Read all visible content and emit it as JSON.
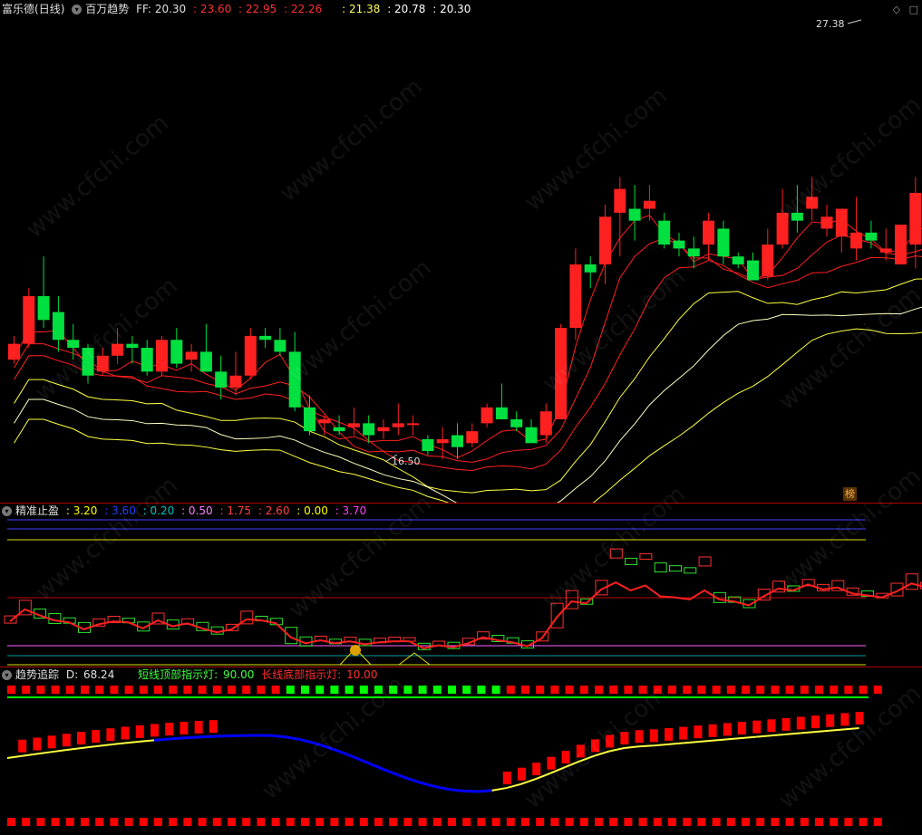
{
  "main": {
    "stock_name": "富乐德",
    "period": "(日线)",
    "indicator": "百万趋势",
    "ff_label": "FF:",
    "ff_value": "20.30",
    "red_values": [
      ": 23.60",
      ": 22.95",
      ": 22.26"
    ],
    "white_values": [
      ": 21.38",
      ": 20.78",
      ": 20.30"
    ],
    "high_label": "27.38",
    "low_label": "16.50",
    "rank_badge": "榜"
  },
  "panel2": {
    "title": "精准止盈",
    "values": [
      {
        "text": ": 3.20",
        "color": "#ffff00"
      },
      {
        "text": ": 3.60",
        "color": "#0000ff"
      },
      {
        "text": ": 0.20",
        "color": "#00c0c0"
      },
      {
        "text": ": 0.50",
        "color": "#ff80ff"
      },
      {
        "text": ": 1.75",
        "color": "#ff4040"
      },
      {
        "text": ": 2.60",
        "color": "#ff4040"
      },
      {
        "text": ": 0.00",
        "color": "#ffff00"
      },
      {
        "text": ": 3.70",
        "color": "#ff40ff"
      }
    ]
  },
  "panel3": {
    "title": "趋势追踪",
    "d_label": "D:",
    "d_value": "68.24",
    "short_label": "短线顶部指示灯:",
    "short_value": "90.00",
    "long_label": "长线底部指示灯:",
    "long_value": "10.00"
  },
  "watermark": "www.cfchi.com",
  "colors": {
    "up": "#ff2020",
    "down": "#00e040",
    "separator": "#b00000",
    "yellow": "#ffff40",
    "blue": "#0000ff"
  },
  "chart_data": {
    "type": "candlestick",
    "high": 27.38,
    "low": 16.5,
    "ohlc": [
      [
        19.0,
        19.6,
        18.9,
        19.4
      ],
      [
        19.4,
        20.8,
        19.3,
        20.6
      ],
      [
        20.6,
        21.6,
        19.8,
        20.0
      ],
      [
        20.2,
        20.6,
        19.2,
        19.5
      ],
      [
        19.5,
        19.9,
        19.0,
        19.3
      ],
      [
        19.3,
        19.4,
        18.4,
        18.6
      ],
      [
        18.7,
        19.3,
        18.6,
        19.1
      ],
      [
        19.1,
        19.8,
        18.9,
        19.4
      ],
      [
        19.4,
        19.6,
        18.9,
        19.3
      ],
      [
        19.3,
        19.5,
        18.6,
        18.7
      ],
      [
        18.7,
        19.6,
        18.6,
        19.5
      ],
      [
        19.5,
        19.8,
        18.8,
        18.9
      ],
      [
        19.0,
        19.4,
        18.7,
        19.2
      ],
      [
        19.2,
        19.9,
        18.7,
        18.7
      ],
      [
        18.7,
        19.1,
        18.0,
        18.3
      ],
      [
        18.3,
        19.2,
        18.1,
        18.6
      ],
      [
        18.6,
        19.8,
        18.5,
        19.6
      ],
      [
        19.6,
        19.8,
        19.3,
        19.5
      ],
      [
        19.5,
        19.8,
        19.1,
        19.2
      ],
      [
        19.2,
        19.7,
        17.7,
        17.8
      ],
      [
        17.8,
        18.1,
        17.1,
        17.2
      ],
      [
        17.4,
        17.6,
        17.1,
        17.5
      ],
      [
        17.3,
        17.6,
        17.1,
        17.2
      ],
      [
        17.3,
        17.8,
        17.1,
        17.4
      ],
      [
        17.4,
        17.6,
        16.9,
        17.1
      ],
      [
        17.2,
        17.5,
        17.0,
        17.3
      ],
      [
        17.3,
        17.9,
        17.1,
        17.4
      ],
      [
        17.4,
        17.6,
        17.1,
        17.4
      ],
      [
        17.0,
        17.1,
        16.6,
        16.7
      ],
      [
        16.9,
        17.3,
        16.5,
        17.0
      ],
      [
        17.1,
        17.4,
        16.5,
        16.8
      ],
      [
        16.9,
        17.4,
        16.8,
        17.2
      ],
      [
        17.4,
        17.9,
        17.3,
        17.8
      ],
      [
        17.8,
        18.4,
        17.6,
        17.5
      ],
      [
        17.5,
        17.7,
        17.2,
        17.3
      ],
      [
        17.3,
        17.5,
        16.9,
        16.9
      ],
      [
        17.1,
        17.9,
        16.9,
        17.7
      ],
      [
        17.5,
        19.9,
        17.5,
        19.8
      ],
      [
        19.8,
        21.8,
        19.5,
        21.4
      ],
      [
        21.4,
        21.6,
        20.8,
        21.2
      ],
      [
        21.4,
        22.9,
        20.9,
        22.6
      ],
      [
        22.7,
        23.6,
        21.6,
        23.3
      ],
      [
        22.8,
        23.4,
        22.0,
        22.5
      ],
      [
        22.8,
        23.4,
        22.5,
        23.0
      ],
      [
        22.5,
        22.7,
        21.8,
        21.9
      ],
      [
        22.0,
        22.2,
        21.6,
        21.8
      ],
      [
        21.8,
        22.1,
        21.3,
        21.6
      ],
      [
        21.9,
        22.7,
        21.5,
        22.5
      ],
      [
        22.3,
        22.5,
        21.4,
        21.6
      ],
      [
        21.6,
        21.7,
        21.3,
        21.4
      ],
      [
        21.5,
        21.7,
        21.1,
        21.0
      ],
      [
        21.1,
        22.3,
        21.0,
        21.9
      ],
      [
        21.9,
        23.3,
        21.8,
        22.7
      ],
      [
        22.7,
        23.4,
        22.2,
        22.5
      ],
      [
        22.8,
        23.6,
        22.5,
        23.1
      ],
      [
        22.3,
        22.9,
        22.1,
        22.6
      ],
      [
        22.1,
        22.8,
        21.7,
        22.8
      ],
      [
        21.8,
        23.1,
        21.5,
        22.2
      ],
      [
        22.2,
        22.5,
        21.8,
        22.0
      ],
      [
        21.7,
        22.3,
        21.5,
        21.8
      ],
      [
        21.4,
        22.0,
        21.5,
        22.4
      ],
      [
        21.9,
        23.6,
        21.3,
        23.2
      ],
      [
        22.5,
        23.7,
        21.9,
        22.8
      ],
      [
        22.8,
        26.2,
        22.1,
        25.6
      ],
      [
        25.3,
        27.38,
        24.6,
        27.1
      ]
    ]
  }
}
